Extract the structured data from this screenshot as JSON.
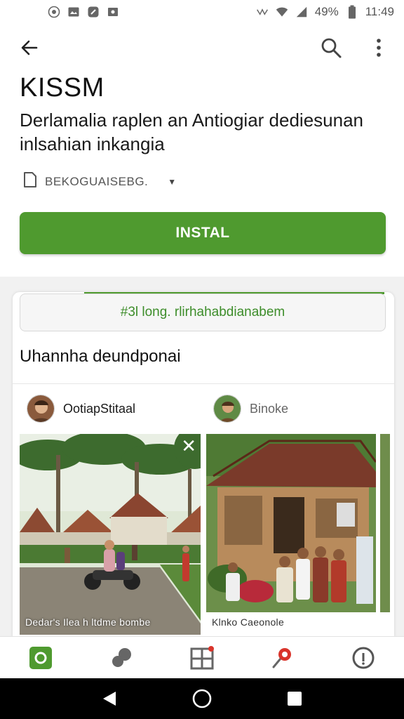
{
  "status_bar": {
    "battery_text": "49%",
    "time": "11:49",
    "left_icons": [
      "radio-icon",
      "gallery-icon",
      "shield-icon",
      "photo-icon"
    ]
  },
  "app": {
    "title": "KISSM",
    "description": "Derlamalia raplen an Antiogiar dediesunan inlsahian inkangia",
    "meta_label": "BEKOGUAISEBG.",
    "install_label": "INSTAL"
  },
  "card": {
    "banner_text": "#3l long. rlirhahabdianabem",
    "heading": "Uhannha deundponai",
    "posts": [
      {
        "author": "OotiapStitaal",
        "caption": "Dedar's Ilea h ltdme bombe"
      },
      {
        "author": "Binoke",
        "caption": "Klnko Caeonole"
      }
    ]
  },
  "colors": {
    "accent": "#4f9a2f",
    "banner_text": "#3d8d2a"
  },
  "bottom_nav": [
    "apps-icon",
    "games-icon",
    "grid-icon",
    "offers-icon",
    "info-icon"
  ]
}
